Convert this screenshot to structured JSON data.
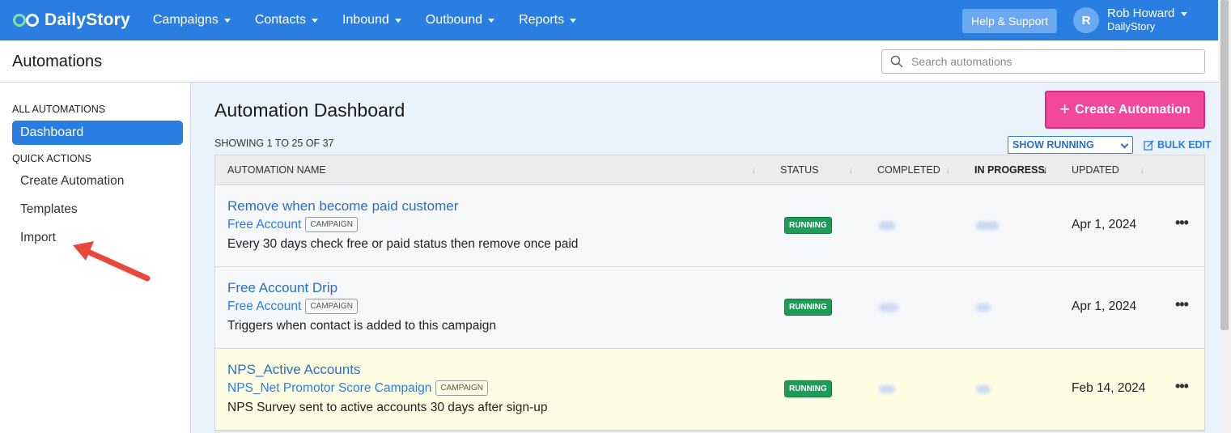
{
  "brand": {
    "name": "DailyStory",
    "color": "#2a7de1"
  },
  "nav": [
    {
      "label": "Campaigns"
    },
    {
      "label": "Contacts"
    },
    {
      "label": "Inbound"
    },
    {
      "label": "Outbound"
    },
    {
      "label": "Reports"
    }
  ],
  "help_label": "Help & Support",
  "user": {
    "initial": "R",
    "name": "Rob Howard",
    "org": "DailyStory"
  },
  "header": {
    "title": "Automations",
    "search_placeholder": "Search automations"
  },
  "sidebar": {
    "section1": "ALL AUTOMATIONS",
    "active": "Dashboard",
    "section2": "QUICK ACTIONS",
    "links": [
      "Create Automation",
      "Templates",
      "Import"
    ]
  },
  "main": {
    "title": "Automation Dashboard",
    "create_label": "Create Automation",
    "showing": "SHOWING 1 TO 25 OF 37",
    "filter_value": "SHOW RUNNING",
    "bulk_label": "BULK EDIT",
    "columns": {
      "name": "AUTOMATION NAME",
      "status": "STATUS",
      "completed": "COMPLETED",
      "in_progress": "IN PROGRESS",
      "updated": "UPDATED"
    },
    "rows": [
      {
        "name": "Remove when become paid customer",
        "campaign": "Free Account",
        "tag": "CAMPAIGN",
        "desc": "Every 30 days check free or paid status then remove once paid",
        "status": "RUNNING",
        "updated": "Apr 1, 2024"
      },
      {
        "name": "Free Account Drip",
        "campaign": "Free Account",
        "tag": "CAMPAIGN",
        "desc": "Triggers when contact is added to this campaign",
        "status": "RUNNING",
        "updated": "Apr 1, 2024"
      },
      {
        "name": "NPS_Active Accounts",
        "campaign": "NPS_Net Promotor Score Campaign",
        "tag": "CAMPAIGN",
        "desc": "NPS Survey sent to active accounts 30 days after sign-up",
        "status": "RUNNING",
        "updated": "Feb 14, 2024"
      }
    ]
  },
  "icons": {
    "logo": "infinity-icon",
    "search": "search-icon",
    "sort": "sort-arrow-icon",
    "more": "more-options-icon",
    "edit": "edit-icon",
    "annotation": "red-arrow-icon"
  },
  "colors": {
    "accent": "#2a7de1",
    "create": "#f0489b",
    "running": "#1d9c57",
    "highlight_row": "#fdfde4"
  }
}
